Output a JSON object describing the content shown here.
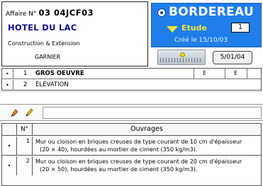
{
  "header": {
    "affaire_label": "Affaire N°",
    "affaire_number": "03 04JCF03",
    "hotel": "HOTEL DU LAC",
    "construction": "Construction & Extension",
    "client": "GARNIER"
  },
  "bordereau": {
    "title": "BORDEREAU",
    "status": "Etude",
    "number": "1",
    "created": "Créé le 15/10/03",
    "date": "5/01/04",
    "colors": {
      "panel": "#1f7eea",
      "accent": "#f4e23a"
    }
  },
  "sections": [
    {
      "bullet": "•",
      "num": "1",
      "label": "GROS OEUVRE",
      "col_e1": "E",
      "col_e2": "E"
    },
    {
      "bullet": "•",
      "num": "2",
      "label": "ÉLÉVATION",
      "col_e1": "",
      "col_e2": ""
    }
  ],
  "toolbar": {
    "icons": [
      "brush-icon",
      "pencil-icon"
    ]
  },
  "table": {
    "headers": {
      "num": "N°",
      "ouvrages": "Ouvrages"
    },
    "rows": [
      {
        "bullet": "•",
        "num": "1",
        "line1": "Mur ou cloison en briques creuses de type courant de 10 cm d'épaisseur",
        "line2": "(20 × 40), hourdées au mortier de ciment (350 kg/m3)."
      },
      {
        "bullet": "•",
        "num": "2",
        "line1": "Mur ou cloison en briques creuses de type courant de 20 cm d'épaisseur",
        "line2": "(20 × 50), hourdées au mortier de ciment (350 kg/m3)."
      }
    ]
  }
}
